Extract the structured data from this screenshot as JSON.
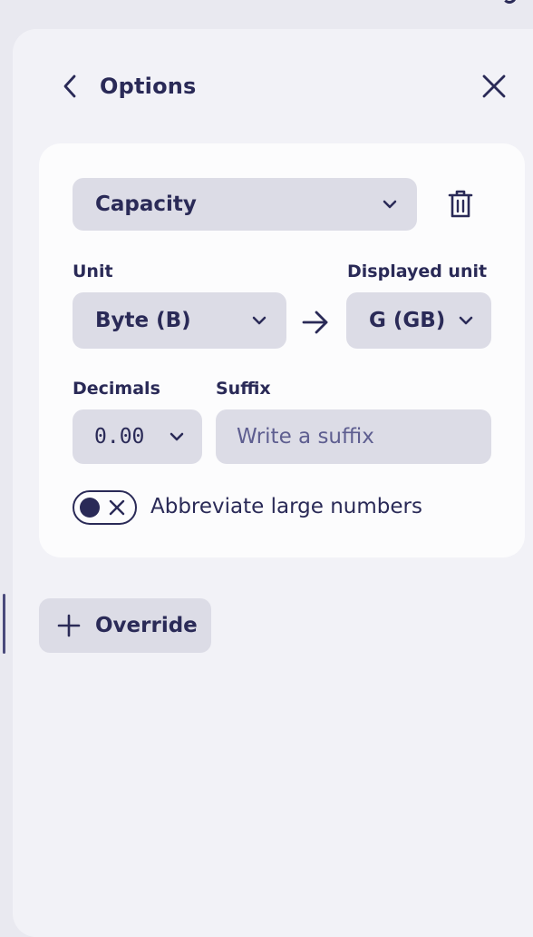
{
  "header": {
    "back_icon": "chevron-left-icon",
    "title": "Options",
    "close_icon": "close-icon"
  },
  "field": {
    "selected": "Capacity",
    "delete_icon": "trash-icon"
  },
  "unit": {
    "label": "Unit",
    "value": "Byte (B)"
  },
  "displayed_unit": {
    "label": "Displayed unit",
    "value": "G (GB)"
  },
  "decimals": {
    "label": "Decimals",
    "value": "0.00"
  },
  "suffix": {
    "label": "Suffix",
    "placeholder": "Write a suffix",
    "value": ""
  },
  "abbreviate": {
    "label": "Abbreviate large numbers",
    "enabled": false
  },
  "override": {
    "label": "Override",
    "icon": "plus-icon"
  },
  "colors": {
    "text": "#2a2a57",
    "panel_bg": "#f2f2f7",
    "card_bg": "#fcfcfd",
    "control_bg": "#dcdce6",
    "placeholder": "#5e5e90"
  }
}
